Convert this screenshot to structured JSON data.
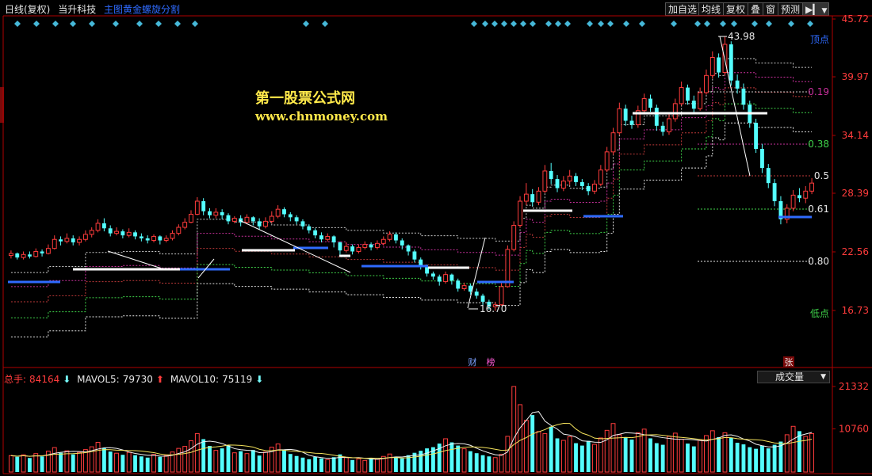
{
  "header": {
    "period": "日线(复权)",
    "stock_name": "当升科技",
    "formula_name": "主图黄金螺旋分割"
  },
  "toolbar": {
    "add_watch": "加自选",
    "ma": "均线",
    "adjust": "复权",
    "overlay": "叠",
    "window": "窗",
    "forecast": "预测"
  },
  "price_axis": {
    "ticks": [
      "45.72",
      "39.97",
      "34.14",
      "28.39",
      "22.56",
      "16.73"
    ],
    "fib_labels": [
      "0.19",
      "0.38",
      "0.5",
      "0.61",
      "0.80"
    ],
    "top_label": "顶点",
    "bottom_label": "低点"
  },
  "annotations": {
    "high_value": "43.98",
    "low_value": "16.70",
    "badge_cai": "财",
    "badge_bang": "榜",
    "badge_zhang": "张"
  },
  "watermark": {
    "line1": "第一股票公式网",
    "line2": "www.chnmoney.com"
  },
  "volume_panel": {
    "total_label": "总手:",
    "total_value": "84164",
    "ma5_label": "MAVOL5:",
    "ma5_value": "79730",
    "ma10_label": "MAVOL10:",
    "ma10_value": "75119",
    "indicator": "成交量",
    "ticks": [
      "21332",
      "10760"
    ]
  },
  "colors": {
    "up": "#ff3c3c",
    "down": "#54ffff",
    "axis": "#b00000",
    "fib_blue": "#2f6bff"
  },
  "chart_data": {
    "type": "candlestick",
    "y_axis_price": {
      "min": 11.0,
      "max": 45.72
    },
    "fib_levels": [
      "0.19",
      "0.38",
      "0.5",
      "0.61",
      "0.80"
    ],
    "high_point": 43.98,
    "low_point": 16.7,
    "candles": [
      [
        22.2,
        22.4,
        22.7,
        21.9
      ],
      [
        22.4,
        22.0,
        22.5,
        21.8
      ],
      [
        22.0,
        22.3,
        22.6,
        21.8
      ],
      [
        22.3,
        22.1,
        22.6,
        21.9
      ],
      [
        22.1,
        22.6,
        22.9,
        22.0
      ],
      [
        22.6,
        22.4,
        22.8,
        22.1
      ],
      [
        22.4,
        22.9,
        23.3,
        22.3
      ],
      [
        22.9,
        23.8,
        24.2,
        22.8
      ],
      [
        23.8,
        23.6,
        24.1,
        23.2
      ],
      [
        23.6,
        23.9,
        24.4,
        23.4
      ],
      [
        23.9,
        23.5,
        24.2,
        23.2
      ],
      [
        23.5,
        23.8,
        24.1,
        23.2
      ],
      [
        23.8,
        24.3,
        24.7,
        23.6
      ],
      [
        24.3,
        24.7,
        25.0,
        24.0
      ],
      [
        24.7,
        25.4,
        25.8,
        24.5
      ],
      [
        25.4,
        24.9,
        25.9,
        24.6
      ],
      [
        24.9,
        24.4,
        25.2,
        24.1
      ],
      [
        24.4,
        24.6,
        25.0,
        24.2
      ],
      [
        24.6,
        24.2,
        24.8,
        23.9
      ],
      [
        24.2,
        24.5,
        24.9,
        24.0
      ],
      [
        24.5,
        24.1,
        24.7,
        23.8
      ],
      [
        24.1,
        23.9,
        24.4,
        23.6
      ],
      [
        23.9,
        23.7,
        24.2,
        23.4
      ],
      [
        23.7,
        24.1,
        24.3,
        23.5
      ],
      [
        24.1,
        23.7,
        24.2,
        23.3
      ],
      [
        23.7,
        23.9,
        24.2,
        23.5
      ],
      [
        23.9,
        24.4,
        24.7,
        23.7
      ],
      [
        24.4,
        25.0,
        25.3,
        24.2
      ],
      [
        25.0,
        25.5,
        25.9,
        24.8
      ],
      [
        25.5,
        26.3,
        26.7,
        25.4
      ],
      [
        26.3,
        27.6,
        28.0,
        26.2
      ],
      [
        27.6,
        26.6,
        27.9,
        26.2
      ],
      [
        26.6,
        26.2,
        26.9,
        25.9
      ],
      [
        26.2,
        26.5,
        26.9,
        25.9
      ],
      [
        26.5,
        26.2,
        26.8,
        25.8
      ],
      [
        26.2,
        25.6,
        26.4,
        25.3
      ],
      [
        25.6,
        25.9,
        26.1,
        25.4
      ],
      [
        25.9,
        25.5,
        26.2,
        25.1
      ],
      [
        25.5,
        26.0,
        26.3,
        25.3
      ],
      [
        26.0,
        25.6,
        26.1,
        25.2
      ],
      [
        25.6,
        25.1,
        25.9,
        24.8
      ],
      [
        25.1,
        25.6,
        26.0,
        24.9
      ],
      [
        25.6,
        26.1,
        26.6,
        25.4
      ],
      [
        26.1,
        26.8,
        27.2,
        25.9
      ],
      [
        26.8,
        26.3,
        27.0,
        26.0
      ],
      [
        26.3,
        26.0,
        26.5,
        25.6
      ],
      [
        26.0,
        25.6,
        26.2,
        25.3
      ],
      [
        25.6,
        25.1,
        25.8,
        24.8
      ],
      [
        25.1,
        24.7,
        25.3,
        24.4
      ],
      [
        24.7,
        24.2,
        24.9,
        23.9
      ],
      [
        24.2,
        23.8,
        24.5,
        23.5
      ],
      [
        23.8,
        24.1,
        24.4,
        23.6
      ],
      [
        24.1,
        23.5,
        24.2,
        23.0
      ],
      [
        23.5,
        22.7,
        23.6,
        22.3
      ],
      [
        22.7,
        23.1,
        23.5,
        22.5
      ],
      [
        23.1,
        22.6,
        23.3,
        22.3
      ],
      [
        22.6,
        23.0,
        23.3,
        22.4
      ],
      [
        23.0,
        23.3,
        23.6,
        22.8
      ],
      [
        23.3,
        23.0,
        23.5,
        22.7
      ],
      [
        23.0,
        23.4,
        23.7,
        22.8
      ],
      [
        23.4,
        23.8,
        24.1,
        23.2
      ],
      [
        23.8,
        24.3,
        24.6,
        23.6
      ],
      [
        24.3,
        23.7,
        24.5,
        23.4
      ],
      [
        23.7,
        23.2,
        23.9,
        22.8
      ],
      [
        23.2,
        22.6,
        23.3,
        22.2
      ],
      [
        22.6,
        21.8,
        22.8,
        21.5
      ],
      [
        21.8,
        21.1,
        22.0,
        20.8
      ],
      [
        21.1,
        20.4,
        21.3,
        20.1
      ],
      [
        20.4,
        20.1,
        20.6,
        19.8
      ],
      [
        20.1,
        19.6,
        20.3,
        19.2
      ],
      [
        19.6,
        20.3,
        20.6,
        19.4
      ],
      [
        20.3,
        19.7,
        20.4,
        19.3
      ],
      [
        19.7,
        18.9,
        19.9,
        18.6
      ],
      [
        18.9,
        19.2,
        19.5,
        18.7
      ],
      [
        19.2,
        18.6,
        19.4,
        18.3
      ],
      [
        18.6,
        18.2,
        18.9,
        17.9
      ],
      [
        18.2,
        17.6,
        18.4,
        17.2
      ],
      [
        17.6,
        17.1,
        17.8,
        16.8
      ],
      [
        17.1,
        17.3,
        17.6,
        16.7
      ],
      [
        17.3,
        19.1,
        19.5,
        17.2
      ],
      [
        19.1,
        22.8,
        23.2,
        19.0
      ],
      [
        22.8,
        25.2,
        25.6,
        22.6
      ],
      [
        25.2,
        27.6,
        28.1,
        25.0
      ],
      [
        27.6,
        28.3,
        29.4,
        27.2
      ],
      [
        28.3,
        27.5,
        28.8,
        27.1
      ],
      [
        27.5,
        28.6,
        29.0,
        27.2
      ],
      [
        28.6,
        30.6,
        31.2,
        28.4
      ],
      [
        30.6,
        29.8,
        31.4,
        29.3
      ],
      [
        29.8,
        28.9,
        30.2,
        28.5
      ],
      [
        28.9,
        29.6,
        30.1,
        28.6
      ],
      [
        29.6,
        30.1,
        30.7,
        29.2
      ],
      [
        30.1,
        29.5,
        30.4,
        29.1
      ],
      [
        29.5,
        29.1,
        29.8,
        28.7
      ],
      [
        29.1,
        28.6,
        29.4,
        28.2
      ],
      [
        28.6,
        29.3,
        29.7,
        28.3
      ],
      [
        29.3,
        30.7,
        31.2,
        29.1
      ],
      [
        30.7,
        32.5,
        33.0,
        30.5
      ],
      [
        32.5,
        34.4,
        34.9,
        32.2
      ],
      [
        34.4,
        36.8,
        37.4,
        34.2
      ],
      [
        36.8,
        35.6,
        37.2,
        35.1
      ],
      [
        35.6,
        35.2,
        36.1,
        34.8
      ],
      [
        35.2,
        36.6,
        37.1,
        34.9
      ],
      [
        36.6,
        37.8,
        38.3,
        36.3
      ],
      [
        37.8,
        36.9,
        38.2,
        36.5
      ],
      [
        36.9,
        35.1,
        37.2,
        34.6
      ],
      [
        35.1,
        34.5,
        35.5,
        34.1
      ],
      [
        34.5,
        35.8,
        36.3,
        34.2
      ],
      [
        35.8,
        37.3,
        37.8,
        35.5
      ],
      [
        37.3,
        38.9,
        39.5,
        37.1
      ],
      [
        38.9,
        37.6,
        39.2,
        37.2
      ],
      [
        37.6,
        36.8,
        38.1,
        36.3
      ],
      [
        36.8,
        38.4,
        38.9,
        36.6
      ],
      [
        38.4,
        40.1,
        40.7,
        38.2
      ],
      [
        40.1,
        41.9,
        42.5,
        39.8
      ],
      [
        41.9,
        40.4,
        42.3,
        39.9
      ],
      [
        40.4,
        43.2,
        43.98,
        40.1
      ],
      [
        43.2,
        39.6,
        43.5,
        39.1
      ],
      [
        39.6,
        38.8,
        40.2,
        38.3
      ],
      [
        38.8,
        37.2,
        39.3,
        36.7
      ],
      [
        37.2,
        35.4,
        37.6,
        34.9
      ],
      [
        35.4,
        32.8,
        35.8,
        32.4
      ],
      [
        32.8,
        30.9,
        33.3,
        30.4
      ],
      [
        30.9,
        29.4,
        31.3,
        28.9
      ],
      [
        29.4,
        27.6,
        29.8,
        27.1
      ],
      [
        27.6,
        25.8,
        28.1,
        25.3
      ],
      [
        25.8,
        26.9,
        27.3,
        25.4
      ],
      [
        26.9,
        28.2,
        28.7,
        26.6
      ],
      [
        28.2,
        27.9,
        28.9,
        27.5
      ],
      [
        27.9,
        28.6,
        29.1,
        27.4
      ],
      [
        28.6,
        29.4,
        29.9,
        28.3
      ]
    ],
    "volumes": [
      4.1,
      3.8,
      4.3,
      3.5,
      4.6,
      3.9,
      5.2,
      6.1,
      4.8,
      5.3,
      4.4,
      4.9,
      5.6,
      6.3,
      7.4,
      6.0,
      5.1,
      4.7,
      4.3,
      4.9,
      4.2,
      3.9,
      3.6,
      4.4,
      3.8,
      4.1,
      5.0,
      5.9,
      6.4,
      7.8,
      9.6,
      8.2,
      6.5,
      5.4,
      5.9,
      6.6,
      4.8,
      5.2,
      4.6,
      5.5,
      4.1,
      5.0,
      6.2,
      7.0,
      5.6,
      4.5,
      4.0,
      3.6,
      3.2,
      3.8,
      3.4,
      3.1,
      3.7,
      4.4,
      3.6,
      3.0,
      3.3,
      2.9,
      3.5,
      3.2,
      3.9,
      4.5,
      3.8,
      3.4,
      4.2,
      4.8,
      5.3,
      5.9,
      6.2,
      7.1,
      8.3,
      7.4,
      6.6,
      5.8,
      5.2,
      4.7,
      4.2,
      3.9,
      3.6,
      4.4,
      8.9,
      21.33,
      16.8,
      12.9,
      14.2,
      10.1,
      9.6,
      11.3,
      8.4,
      7.9,
      8.8,
      7.2,
      6.6,
      7.8,
      6.9,
      8.5,
      10.4,
      12.1,
      9.3,
      8.7,
      8.1,
      9.8,
      10.7,
      8.4,
      7.2,
      6.8,
      8.9,
      9.7,
      8.2,
      7.1,
      6.4,
      7.9,
      9.1,
      10.3,
      8.7,
      9.8,
      8.5,
      7.3,
      6.9,
      6.2,
      5.8,
      6.6,
      5.9,
      6.8,
      7.6,
      9.3,
      11.4,
      10.2,
      8.9,
      9.6
    ],
    "ma5_vol": "MAVOL5: 79730",
    "ma10_vol": "MAVOL10: 75119"
  }
}
